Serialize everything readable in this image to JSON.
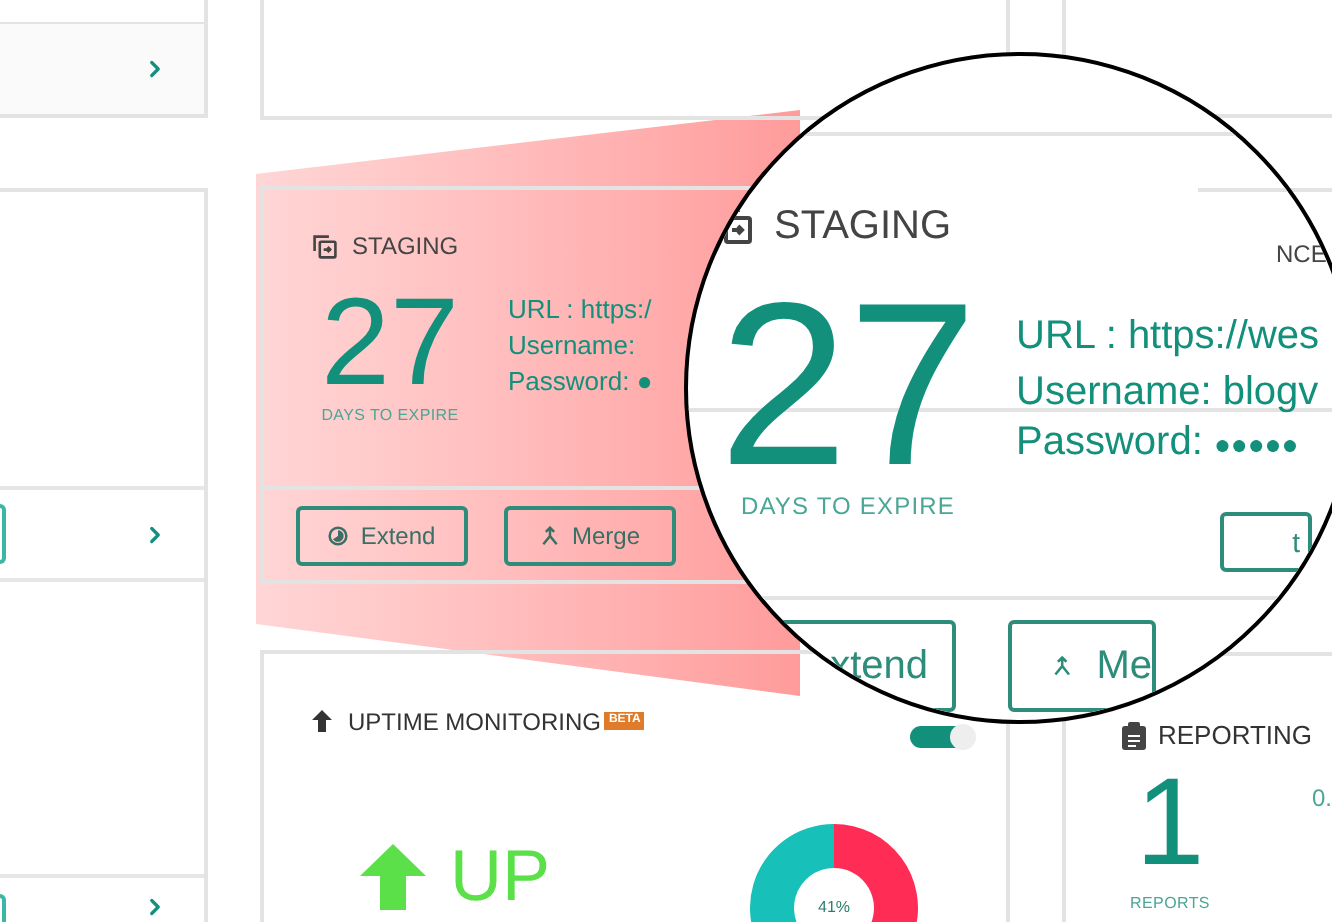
{
  "staging": {
    "title": "STAGING",
    "days": "27",
    "days_label": "DAYS TO EXPIRE",
    "url": "URL : https:/",
    "username": "Username:",
    "password": "Password:",
    "password_mask": "●",
    "buttons": [
      "Extend",
      "Merge"
    ]
  },
  "magnifier": {
    "title": "STAGING",
    "side_title": "NCE",
    "days": "27",
    "days_label": "DAYS TO EXPIRE",
    "url": "URL : https://wes",
    "username": "Username: blogv",
    "password": "Password:",
    "password_mask": "●●●●●",
    "side_button": "t",
    "buttons": [
      "xtend",
      "Me"
    ]
  },
  "uptime": {
    "title": "UPTIME MONITORING",
    "badge": "BETA",
    "toggle": {
      "on": true
    },
    "status": "UP",
    "chart_data": {
      "type": "donut",
      "values": [
        41,
        59
      ],
      "annotations": [
        "41%"
      ]
    }
  },
  "reporting": {
    "title": "REPORTING",
    "count": "1",
    "count_label": "REPORTS",
    "value": "0."
  }
}
